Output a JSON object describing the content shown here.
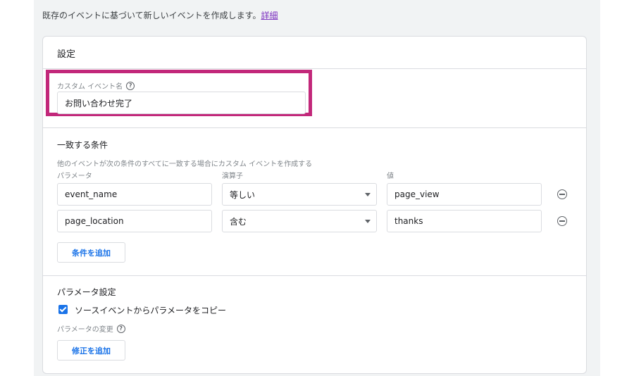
{
  "intro": {
    "text": "既存のイベントに基づいて新しいイベントを作成します。",
    "link": "詳細"
  },
  "card": {
    "title": "設定",
    "custom_event": {
      "label": "カスタム イベント名",
      "help_icon": "help-circle-icon",
      "value": "お問い合わせ完了"
    },
    "conditions": {
      "title": "一致する条件",
      "hint": "他のイベントが次の条件のすべてに一致する場合にカスタム イベントを作成する",
      "col_param": "パラメータ",
      "col_operator": "演算子",
      "col_value": "値",
      "rows": [
        {
          "param": "event_name",
          "operator": "等しい",
          "value": "page_view"
        },
        {
          "param": "page_location",
          "operator": "含む",
          "value": "thanks"
        }
      ],
      "add_button": "条件を追加"
    },
    "params": {
      "title": "パラメータ設定",
      "copy_label": "ソースイベントからパラメータをコピー",
      "copy_checked": true,
      "modify_label": "パラメータの変更",
      "modify_button": "修正を追加"
    }
  },
  "colors": {
    "highlight": "#c2287a",
    "accent": "#1a73e8",
    "link": "#7b2fbf"
  }
}
